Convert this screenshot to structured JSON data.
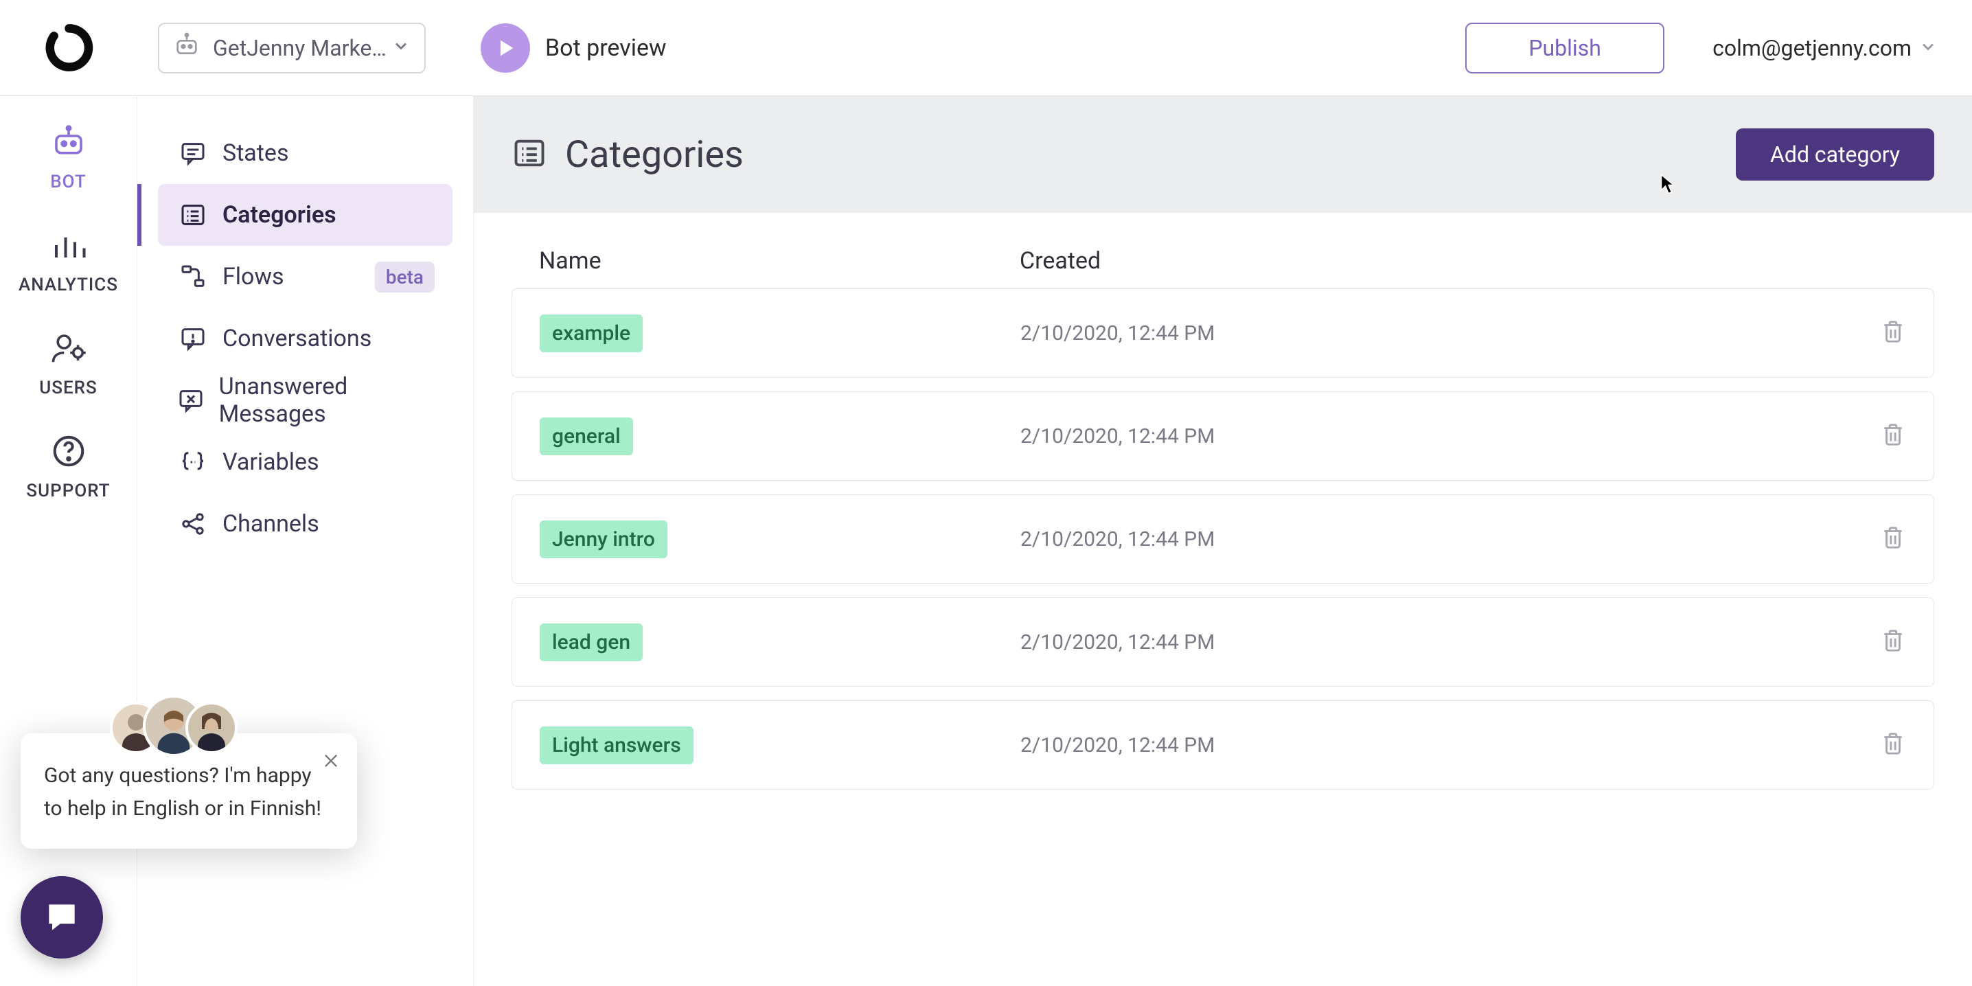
{
  "header": {
    "bot_selector_text": "GetJenny Marketi...",
    "preview_label": "Bot preview",
    "publish_label": "Publish",
    "user_email": "colm@getjenny.com"
  },
  "rail": {
    "items": [
      {
        "label": "BOT",
        "icon": "robot",
        "active": true
      },
      {
        "label": "ANALYTICS",
        "icon": "chart",
        "active": false
      },
      {
        "label": "USERS",
        "icon": "users-gear",
        "active": false
      },
      {
        "label": "SUPPORT",
        "icon": "help",
        "active": false
      }
    ]
  },
  "sidebar": {
    "items": [
      {
        "label": "States",
        "icon": "chat-square",
        "badge": ""
      },
      {
        "label": "Categories",
        "icon": "list",
        "badge": "",
        "active": true
      },
      {
        "label": "Flows",
        "icon": "flow",
        "badge": "beta"
      },
      {
        "label": "Conversations",
        "icon": "warning-chat",
        "badge": ""
      },
      {
        "label": "Unanswered Messages",
        "icon": "x-chat",
        "badge": ""
      },
      {
        "label": "Variables",
        "icon": "braces",
        "badge": ""
      },
      {
        "label": "Channels",
        "icon": "share-nodes",
        "badge": ""
      }
    ]
  },
  "main": {
    "title": "Categories",
    "add_button": "Add category",
    "columns": {
      "name": "Name",
      "created": "Created"
    },
    "rows": [
      {
        "name": "example",
        "created": "2/10/2020, 12:44 PM"
      },
      {
        "name": "general",
        "created": "2/10/2020, 12:44 PM"
      },
      {
        "name": "Jenny intro",
        "created": "2/10/2020, 12:44 PM"
      },
      {
        "name": "lead gen",
        "created": "2/10/2020, 12:44 PM"
      },
      {
        "name": "Light answers",
        "created": "2/10/2020, 12:44 PM"
      }
    ]
  },
  "chat_popup": {
    "message": "Got any questions? I'm happy to help in English or in Finnish!"
  }
}
